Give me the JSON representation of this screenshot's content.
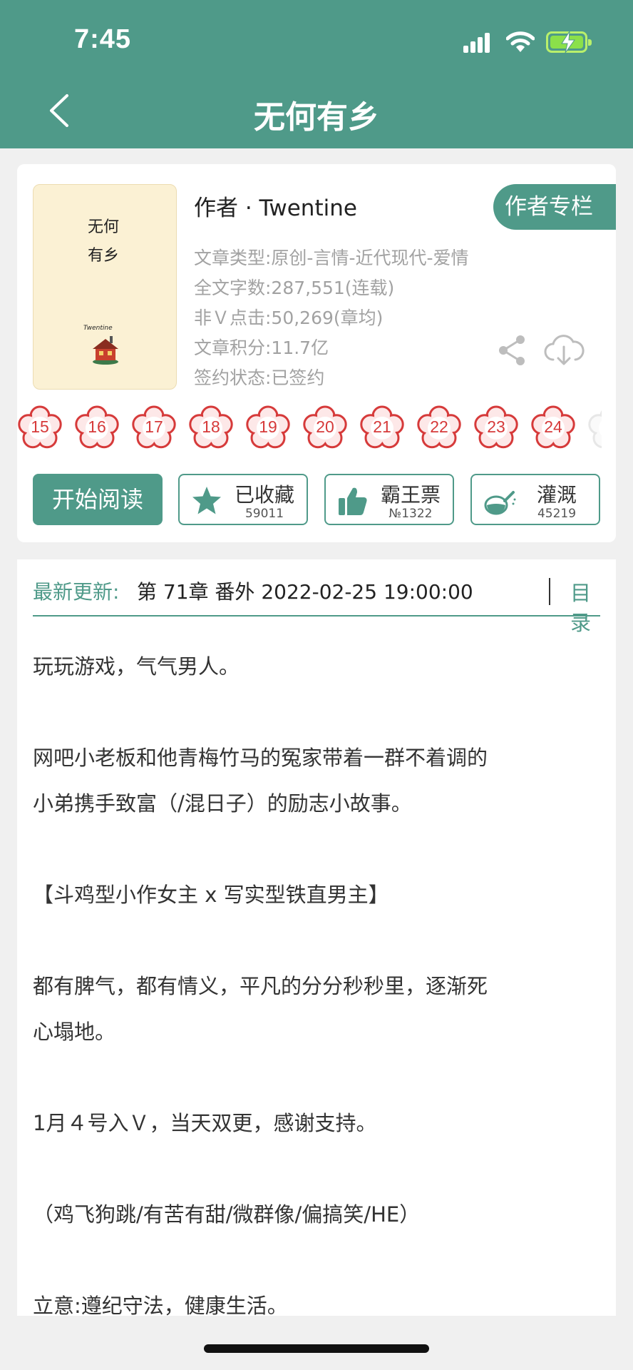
{
  "status_bar": {
    "time": "7:45"
  },
  "nav": {
    "title": "无何有乡"
  },
  "book": {
    "cover": {
      "title_vertical": "无何有乡",
      "author": "Twentine"
    },
    "author_line": "作者 · Twentine",
    "author_column_button": "作者专栏",
    "meta": {
      "type": "文章类型:原创-言情-近代现代-爱情",
      "word_count": "全文字数:287,551(连载)",
      "clicks": "非Ｖ点击:50,269(章均)",
      "score": "文章积分:11.7亿",
      "sign_status": "签约状态:已签约"
    },
    "flower_badges": [
      "15",
      "16",
      "17",
      "18",
      "19",
      "20",
      "21",
      "22",
      "23",
      "24"
    ]
  },
  "actions": {
    "read": "开始阅读",
    "favorite": {
      "label": "已收藏",
      "count": "59011"
    },
    "vote": {
      "label": "霸王票",
      "count": "№1322"
    },
    "water": {
      "label": "灌溉",
      "count": "45219"
    }
  },
  "update": {
    "label": "最新更新:",
    "chapter": "第 71章  番外  2022-02-25 19:00:00",
    "toc": "目录"
  },
  "intro": [
    "玩玩游戏，气气男人。",
    "网吧小老板和他青梅竹马的冤家带着一群不着调的",
    "小弟携手致富（/混日子）的励志小故事。",
    "【斗鸡型小作女主 x 写实型铁直男主】",
    "都有脾气，都有情义，平凡的分分秒秒里，逐渐死",
    "心塌地。",
    "1月４号入Ｖ，当天双更，感谢支持。",
    "（鸡飞狗跳/有苦有甜/微群像/偏搞笑/HE）",
    "立意:遵纪守法，健康生活。"
  ],
  "colors": {
    "accent": "#4f9a89",
    "flower": "#d63a3a",
    "meta_text": "#a2a2a2"
  },
  "icons": [
    "back-icon",
    "share-icon",
    "download-icon",
    "star-icon",
    "thumbs-up-icon",
    "watering-can-icon",
    "flower-icon"
  ]
}
